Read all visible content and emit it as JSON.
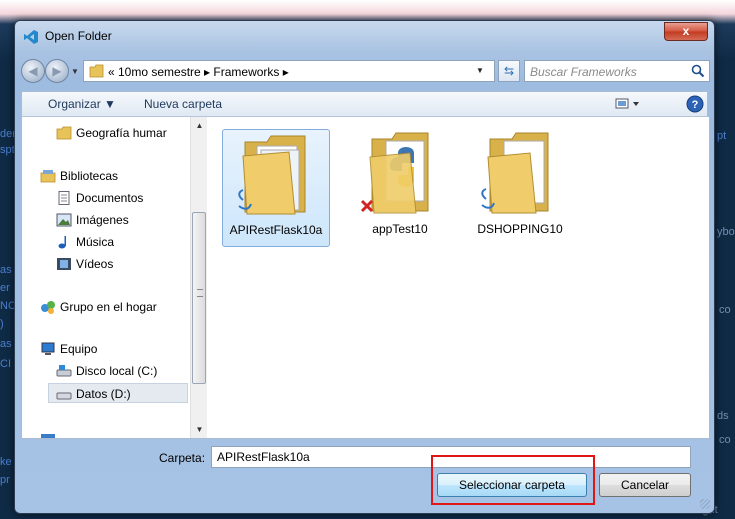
{
  "window": {
    "title": "Open Folder",
    "close_label": "x"
  },
  "address_bar": {
    "path_text": "« 10mo semestre ▸ Frameworks ▸",
    "search_placeholder": "Buscar Frameworks"
  },
  "toolbar": {
    "organize_label": "Organizar ▼",
    "new_folder_label": "Nueva carpeta"
  },
  "nav": {
    "items": [
      {
        "label": "Geografía humar",
        "icon": "folder-icon"
      },
      {
        "label": "Bibliotecas",
        "icon": "library-icon"
      },
      {
        "label": "Documentos",
        "icon": "documents-icon"
      },
      {
        "label": "Imágenes",
        "icon": "pictures-icon"
      },
      {
        "label": "Música",
        "icon": "music-icon"
      },
      {
        "label": "Vídeos",
        "icon": "videos-icon"
      },
      {
        "label": "Grupo en el hogar",
        "icon": "homegroup-icon"
      },
      {
        "label": "Equipo",
        "icon": "computer-icon"
      },
      {
        "label": "Disco local (C:)",
        "icon": "drive-icon"
      },
      {
        "label": "Datos (D:)",
        "icon": "drive-icon"
      }
    ]
  },
  "files": [
    {
      "name": "APIRestFlask10a",
      "badge": "sync"
    },
    {
      "name": "appTest10",
      "badge": "error"
    },
    {
      "name": "DSHOPPING10",
      "badge": "sync"
    }
  ],
  "footer": {
    "folder_label": "Carpeta:",
    "folder_value": "APIRestFlask10a",
    "select_button": "Seleccionar carpeta",
    "cancel_button": "Cancelar"
  },
  "background": {
    "texts": [
      "dem",
      "spt",
      "as",
      "er",
      "NC",
      ")",
      "as",
      "CI",
      "pt",
      "ybo",
      "co",
      "ds",
      "co",
      "ke",
      "pr",
      "ight"
    ]
  }
}
